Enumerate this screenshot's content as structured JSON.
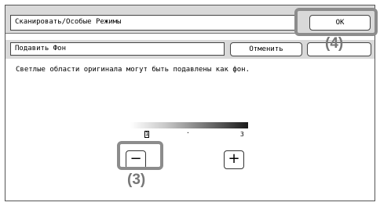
{
  "window": {
    "title": "Сканировать/Особые Режимы"
  },
  "header": {
    "ok_label": "OK"
  },
  "setting": {
    "name": "Подавить Фон",
    "cancel_label": "Отменить",
    "description": "Светлые области оригинала могут быть подавлены как фон."
  },
  "scale": {
    "min_label": "1",
    "mid_label": "·",
    "max_label": "3",
    "selected_value": 1,
    "minus_label": "−",
    "plus_label": "+"
  },
  "annotations": {
    "minus_callout": "(3)",
    "ok_callout": "(4)"
  },
  "colors": {
    "bar_background": "#d9d9d9",
    "highlight": "#8c8c8c",
    "callout_text": "#777777"
  }
}
